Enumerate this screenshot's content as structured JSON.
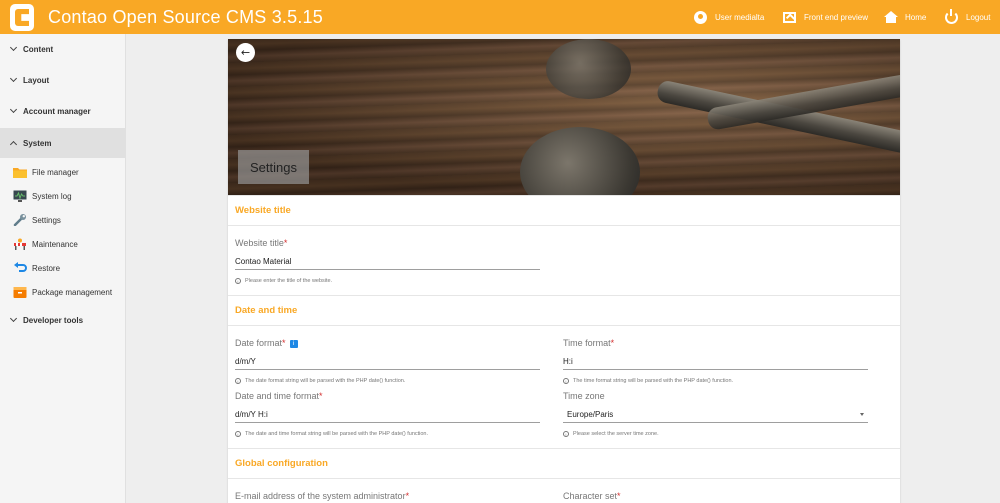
{
  "header": {
    "app_title": "Contao Open Source CMS 3.5.15",
    "nav": [
      {
        "icon": "user-icon",
        "label": "User medialta"
      },
      {
        "icon": "preview-icon",
        "label": "Front end preview"
      },
      {
        "icon": "home-icon",
        "label": "Home"
      },
      {
        "icon": "power-icon",
        "label": "Logout"
      }
    ]
  },
  "sidebar": {
    "groups": [
      {
        "label": "Content",
        "state": "collapsed"
      },
      {
        "label": "Layout",
        "state": "collapsed"
      },
      {
        "label": "Account manager",
        "state": "collapsed"
      },
      {
        "label": "System",
        "state": "expanded"
      },
      {
        "label": "Developer tools",
        "state": "collapsed"
      }
    ],
    "system_items": [
      {
        "icon": "folder-icon",
        "label": "File manager"
      },
      {
        "icon": "monitor-icon",
        "label": "System log"
      },
      {
        "icon": "wrench-icon",
        "label": "Settings"
      },
      {
        "icon": "maintenance-icon",
        "label": "Maintenance"
      },
      {
        "icon": "restore-icon",
        "label": "Restore"
      },
      {
        "icon": "package-icon",
        "label": "Package management"
      }
    ]
  },
  "page": {
    "back_label": "←",
    "title": "Settings"
  },
  "sections": {
    "website": {
      "title": "Website title",
      "field_label": "Website title",
      "value": "Contao Material",
      "help": "Please enter the title of the website."
    },
    "datetime": {
      "title": "Date and time",
      "date_format_label": "Date format",
      "date_format_value": "d/m/Y",
      "date_format_help": "The date format string will be parsed with the PHP date() function.",
      "time_format_label": "Time format",
      "time_format_value": "H:i",
      "time_format_help": "The time format string will be parsed with the PHP date() function.",
      "datim_format_label": "Date and time format",
      "datim_format_value": "d/m/Y H:i",
      "datim_format_help": "The date and time format string will be parsed with the PHP date() function.",
      "timezone_label": "Time zone",
      "timezone_value": "Europe/Paris",
      "timezone_help": "Please select the server time zone."
    },
    "global": {
      "title": "Global configuration",
      "admin_email_label": "E-mail address of the system administrator",
      "charset_label": "Character set"
    }
  },
  "required_marker": "*",
  "info_marker": "i",
  "help_marker": "i",
  "colors": {
    "header": "#f9a825",
    "section_title": "#f9a825",
    "required": "#d32f2f",
    "info_badge": "#1e88e5"
  }
}
